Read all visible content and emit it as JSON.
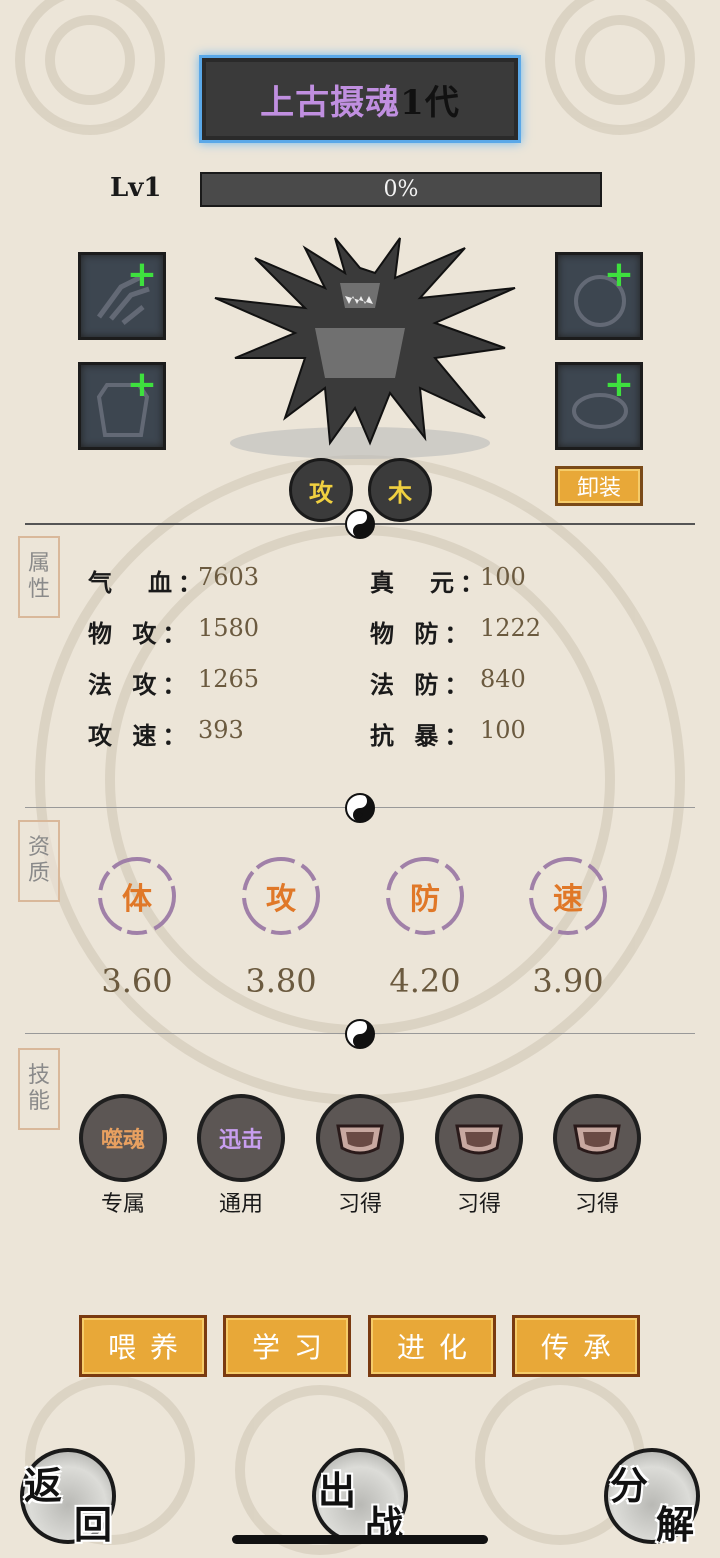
{
  "header": {
    "title_name": "上古摄魂",
    "title_gen": "1代"
  },
  "level": {
    "label": "Lv1",
    "exp_text": "0%",
    "exp_progress": 0
  },
  "equipment": {
    "slot_plus": "+",
    "unequip_label": "卸装"
  },
  "elements": [
    "攻",
    "木"
  ],
  "attributes": {
    "tag": [
      "属",
      "性"
    ],
    "rows": [
      {
        "label": "气　血：",
        "value": "7603"
      },
      {
        "label": "真　元：",
        "value": "100"
      },
      {
        "label": "物 攻：",
        "value": "1580"
      },
      {
        "label": "物 防：",
        "value": "1222"
      },
      {
        "label": "法 攻：",
        "value": "1265"
      },
      {
        "label": "法 防：",
        "value": "840"
      },
      {
        "label": "攻 速：",
        "value": "393"
      },
      {
        "label": "抗 暴：",
        "value": "100"
      }
    ]
  },
  "aptitude": {
    "tag": [
      "资",
      "质"
    ],
    "items": [
      {
        "label": "体",
        "value": "3.60"
      },
      {
        "label": "攻",
        "value": "3.80"
      },
      {
        "label": "防",
        "value": "4.20"
      },
      {
        "label": "速",
        "value": "3.90"
      }
    ]
  },
  "skills": {
    "tag": [
      "技",
      "能"
    ],
    "items": [
      {
        "name": "噬魂",
        "caption": "专属",
        "color": "#e8a060"
      },
      {
        "name": "迅击",
        "caption": "通用",
        "color": "#c89ef0"
      },
      {
        "name": "",
        "caption": "习得",
        "icon": "lock-icon"
      },
      {
        "name": "",
        "caption": "习得",
        "icon": "lock-icon"
      },
      {
        "name": "",
        "caption": "习得",
        "icon": "lock-icon"
      }
    ]
  },
  "actions": [
    "喂养",
    "学习",
    "进化",
    "传承"
  ],
  "nav": {
    "back": [
      "返",
      "回"
    ],
    "battle": [
      "出",
      "战"
    ],
    "decompose": [
      "分",
      "解"
    ]
  },
  "colors": {
    "accent_orange": "#e8a838",
    "title_purple": "#c08fe0",
    "plus_green": "#3ee03e"
  }
}
